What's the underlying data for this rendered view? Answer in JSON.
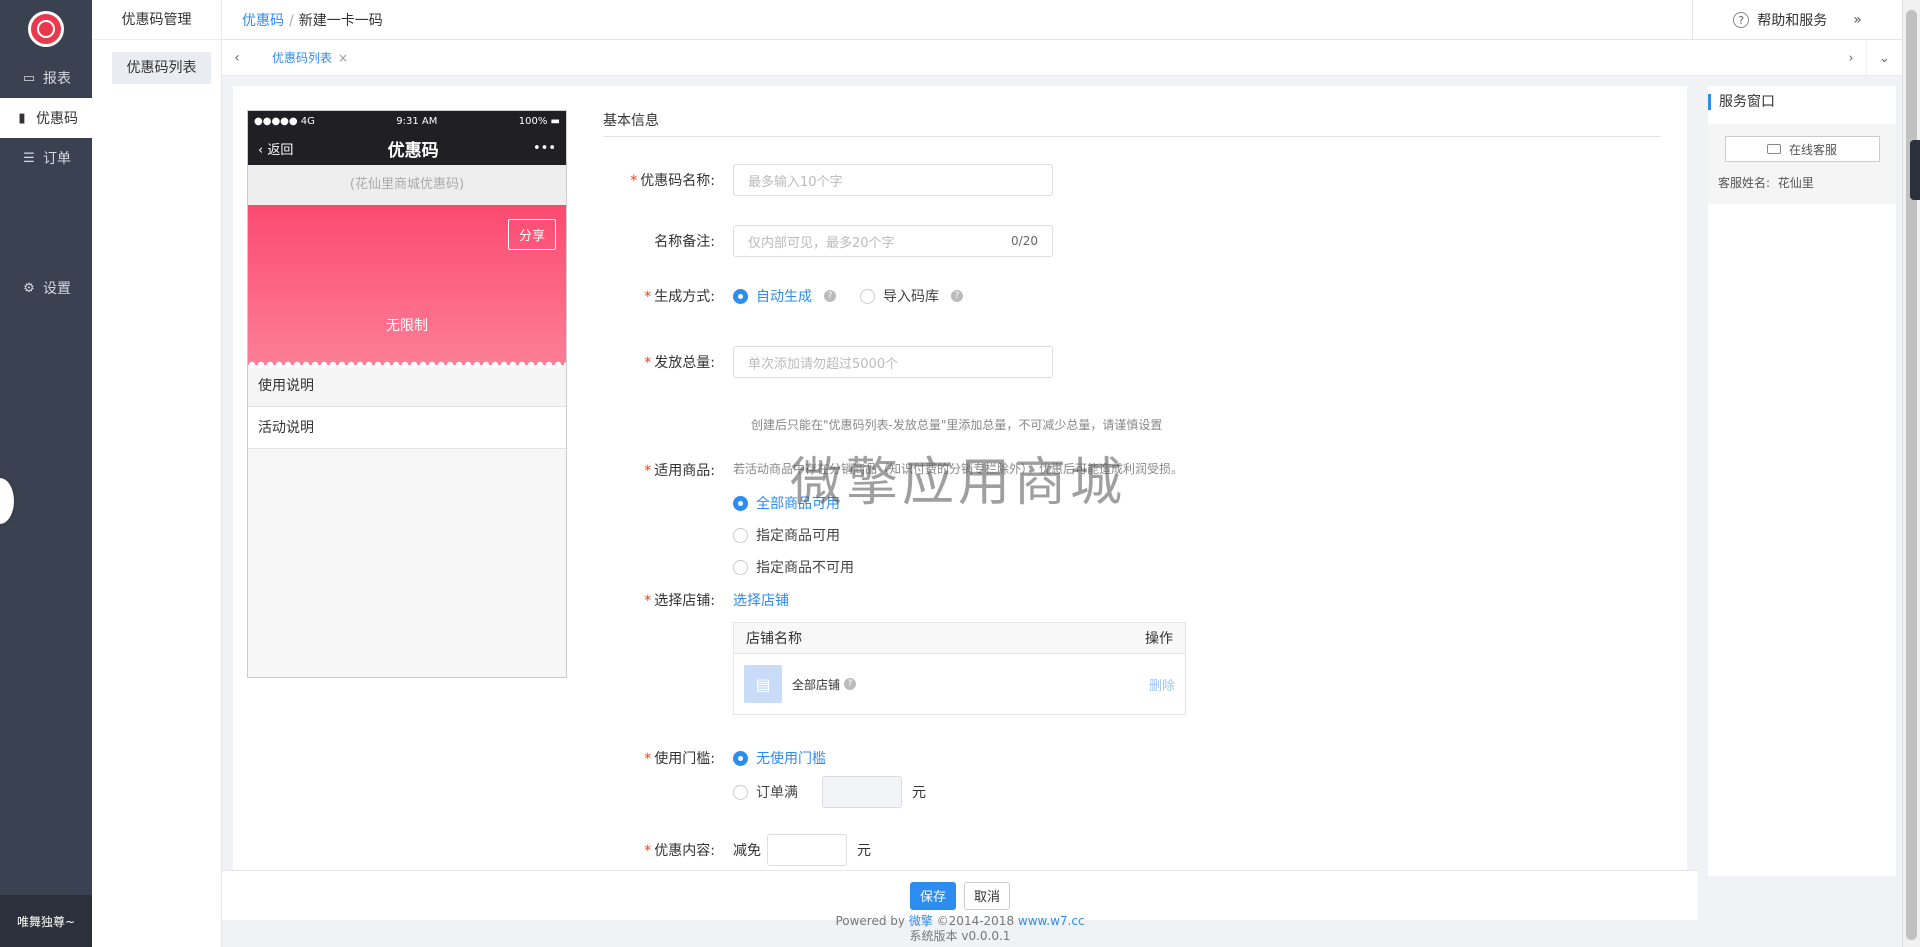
{
  "sidebar": {
    "items": [
      {
        "icon": "report-icon",
        "label": "报表"
      },
      {
        "icon": "bar-chart-icon",
        "label": "优惠码"
      },
      {
        "icon": "order-icon",
        "label": "订单"
      }
    ],
    "settings": {
      "icon": "gear-icon",
      "label": "设置"
    },
    "user": "唯舞独尊~"
  },
  "subnav": {
    "title": "优惠码管理",
    "item": "优惠码列表"
  },
  "header": {
    "breadcrumb_link": "优惠码",
    "breadcrumb_sep": "/",
    "breadcrumb_current": "新建一卡一码",
    "help": "帮助和服务"
  },
  "tabs": [
    {
      "label": "优惠码列表"
    }
  ],
  "phone": {
    "signal": "●●●●● 4G",
    "time": "9:31 AM",
    "battery": "100%",
    "back": "返回",
    "title": "优惠码",
    "more": "•••",
    "subtitle": "(花仙里商城优惠码)",
    "share": "分享",
    "card_label": "无限制",
    "rows": [
      "使用说明",
      "活动说明"
    ]
  },
  "form": {
    "section": "基本信息",
    "name": {
      "label": "优惠码名称:",
      "placeholder": "最多输入10个字"
    },
    "remark": {
      "label": "名称备注:",
      "placeholder": "仅内部可见，最多20个字",
      "count": "0/20"
    },
    "gen": {
      "label": "生成方式:",
      "options": [
        "自动生成",
        "导入码库"
      ]
    },
    "total": {
      "label": "发放总量:",
      "placeholder": "单次添加请勿超过5000个",
      "hint": "创建后只能在\"优惠码列表-发放总量\"里添加总量，不可减少总量，请谨慎设置"
    },
    "goods": {
      "label": "适用商品:",
      "hint": "若活动商品中存在分销商品（知识付费的分销专栏除外），优惠后可能造成利润受损。",
      "options": [
        "全部商品可用",
        "指定商品可用",
        "指定商品不可用"
      ]
    },
    "store": {
      "label": "选择店铺:",
      "link": "选择店铺",
      "col_name": "店铺名称",
      "col_op": "操作",
      "row_name": "全部店铺",
      "row_op": "删除"
    },
    "threshold": {
      "label": "使用门槛:",
      "options": [
        "无使用门槛",
        "订单满"
      ],
      "unit": "元"
    },
    "discount": {
      "label": "优惠内容:",
      "prefix": "减免",
      "unit": "元"
    }
  },
  "watermark": "微擎应用商城",
  "service": {
    "title": "服务窗口",
    "button": "在线客服",
    "name_label": "客服姓名:",
    "name": "花仙里"
  },
  "actions": {
    "save": "保存",
    "cancel": "取消"
  },
  "footer": {
    "powered": "Powered by",
    "brand": "微擎",
    "copyright": "©2014-2018",
    "site": "www.w7.cc",
    "version": "系统版本 v0.0.0.1"
  },
  "colors": {
    "accent": "#2d8cf0",
    "sidebar": "#3a4150",
    "card": "#fb4a70",
    "required": "#ed4014"
  }
}
